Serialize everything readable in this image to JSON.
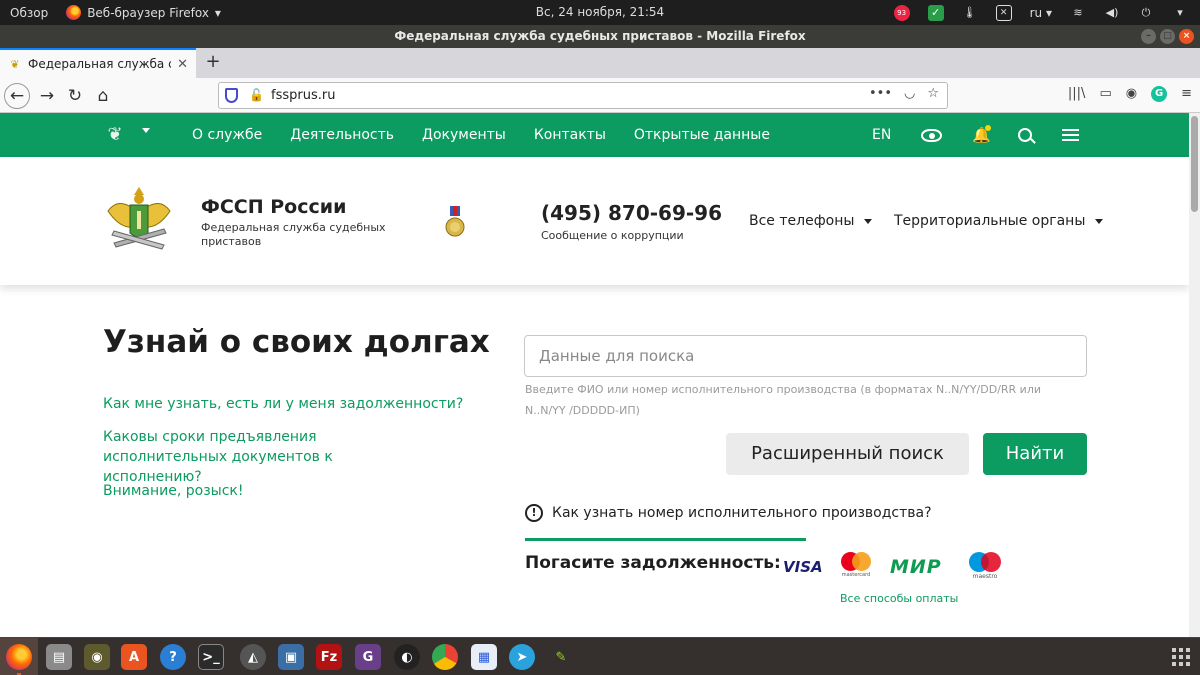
{
  "system_bar": {
    "activities": "Обзор",
    "app_menu": "Веб-браузер Firefox",
    "clock": "Вс, 24 ноября, 21:54",
    "tray_badge": "93",
    "keyboard_layout": "ru"
  },
  "window": {
    "title": "Федеральная служба судебных приставов - Mozilla Firefox"
  },
  "tab": {
    "title": "Федеральная служба судебных приставов"
  },
  "urlbar": {
    "url": "fssprus.ru",
    "more": "•••"
  },
  "site_nav": {
    "links": [
      "О службе",
      "Деятельность",
      "Документы",
      "Контакты",
      "Открытые данные"
    ],
    "lang": "EN"
  },
  "header": {
    "org_title": "ФССП России",
    "org_subtitle": "Федеральная служба судебных приставов",
    "phone": "(495) 870-69-96",
    "phone_sub": "Сообщение о коррупции",
    "all_phones": "Все телефоны",
    "territorial": "Территориальные органы"
  },
  "main": {
    "hero_title": "Узнай о своих долгах",
    "links": [
      "Как мне узнать, есть ли у меня задолженности?",
      "Каковы сроки предъявления исполнительных документов к исполнению?",
      "Внимание, розыск!"
    ],
    "search_placeholder": "Данные для поиска",
    "search_hint": "Введите ФИО или номер исполнительного производства (в форматах N..N/YY/DD/RR или N..N/YY /DDDDD-ИП)",
    "advanced_search": "Расширенный поиск",
    "find_button": "Найти",
    "info_link": "Как узнать номер исполнительного производства?",
    "pay_label": "Погасите задолженность:",
    "pay_visa": "VISA",
    "pay_mastercard": "mastercard",
    "pay_mir": "МИР",
    "pay_maestro": "maestro",
    "all_payments": "Все способы оплаты"
  },
  "colors": {
    "brand_green": "#0c9b60",
    "dock_bg": "#35302e",
    "topbar_bg": "#1e1e1e"
  }
}
